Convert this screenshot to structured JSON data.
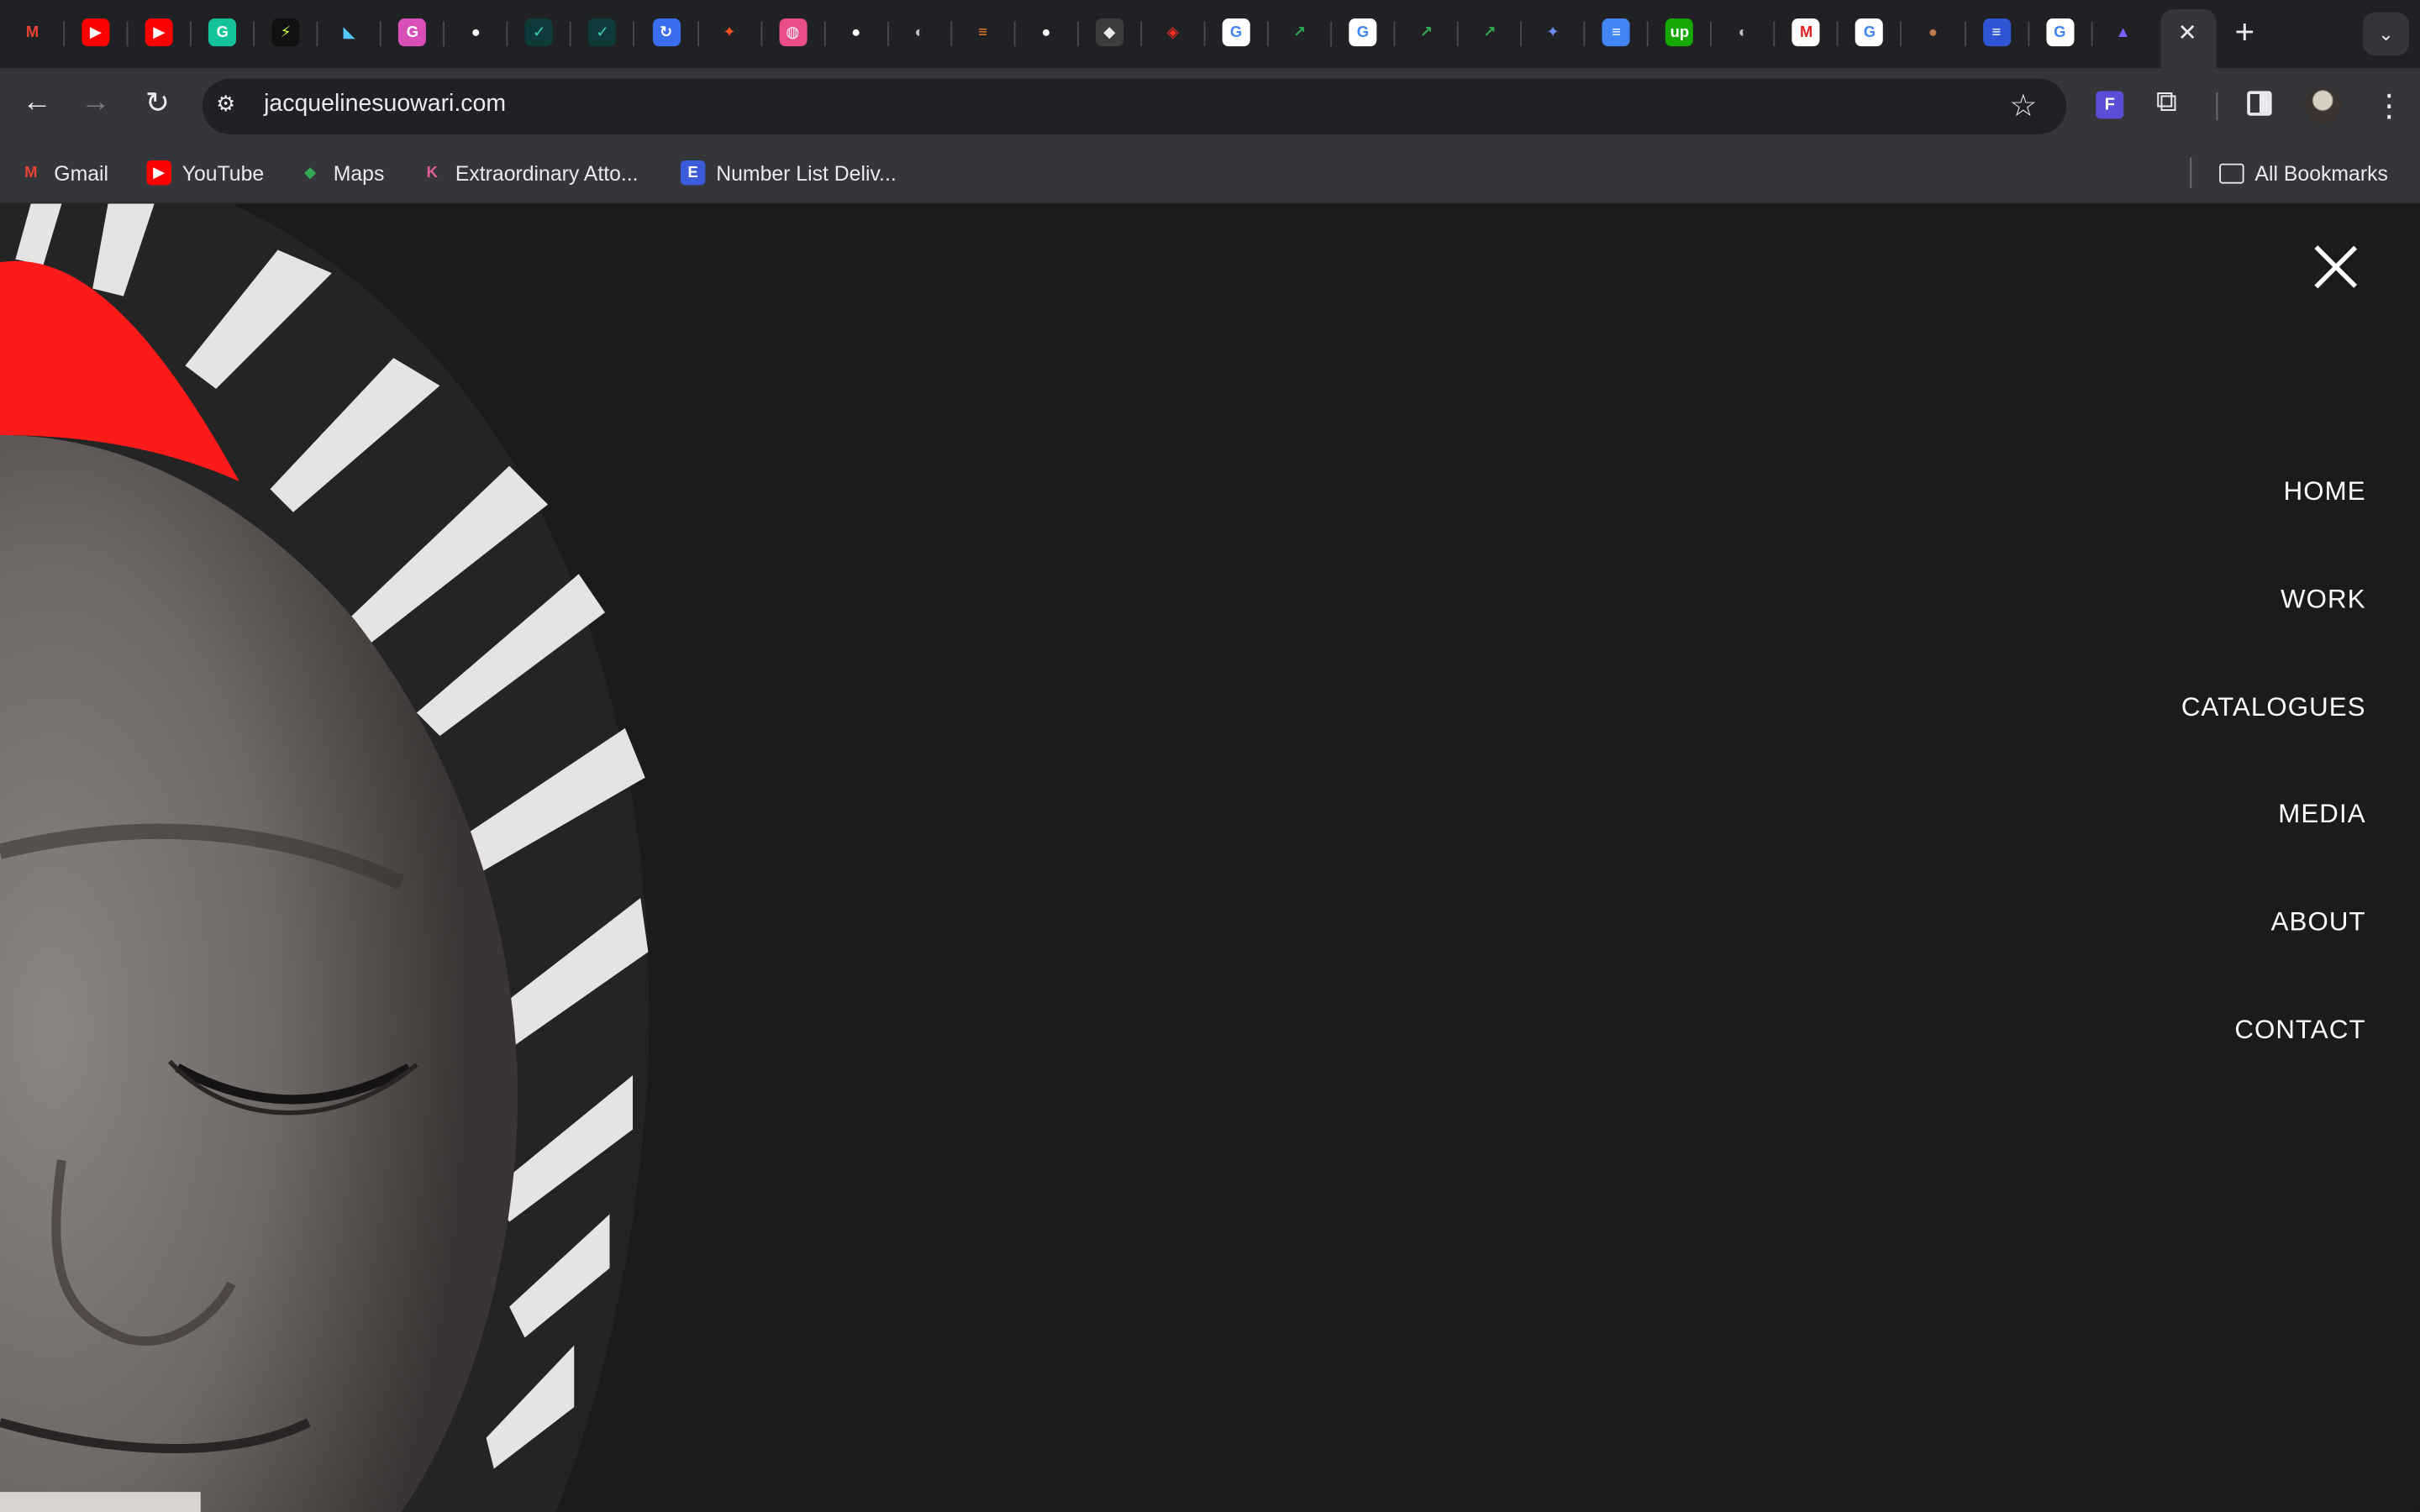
{
  "browser": {
    "tabs": [
      {
        "icon": "gmail-icon",
        "glyph": "M",
        "color": "#ea4335",
        "bg": "transparent"
      },
      {
        "icon": "youtube-icon",
        "glyph": "▶",
        "color": "#ffffff",
        "bg": "#ff0000"
      },
      {
        "icon": "youtube-icon",
        "glyph": "▶",
        "color": "#ffffff",
        "bg": "#ff0000"
      },
      {
        "icon": "grammarly-icon",
        "glyph": "G",
        "color": "#ffffff",
        "bg": "#15c39a"
      },
      {
        "icon": "bolt-icon",
        "glyph": "⚡",
        "color": "#c8ff3c",
        "bg": "#111111"
      },
      {
        "icon": "flutter-icon",
        "glyph": "◣",
        "color": "#54c5f8",
        "bg": "transparent"
      },
      {
        "icon": "g-icon",
        "glyph": "G",
        "color": "#ffffff",
        "bg": "#d94fb8"
      },
      {
        "icon": "github-icon",
        "glyph": "●",
        "color": "#ffffff",
        "bg": "transparent"
      },
      {
        "icon": "check-icon",
        "glyph": "✓",
        "color": "#38d6b0",
        "bg": "#0e3b3a"
      },
      {
        "icon": "check-icon",
        "glyph": "✓",
        "color": "#38d6b0",
        "bg": "#0e3b3a"
      },
      {
        "icon": "link-icon",
        "glyph": "↻",
        "color": "#ffffff",
        "bg": "#3a6df0"
      },
      {
        "icon": "figma-icon",
        "glyph": "✦",
        "color": "#f24e1e",
        "bg": "transparent"
      },
      {
        "icon": "dribbble-icon",
        "glyph": "◍",
        "color": "#ffffff",
        "bg": "#ea4c89"
      },
      {
        "icon": "github-icon",
        "glyph": "●",
        "color": "#ffffff",
        "bg": "transparent"
      },
      {
        "icon": "globe-icon",
        "glyph": "◐",
        "color": "#bdc1c6",
        "bg": "transparent"
      },
      {
        "icon": "stackoverflow-icon",
        "glyph": "≡",
        "color": "#f48024",
        "bg": "transparent"
      },
      {
        "icon": "github-icon",
        "glyph": "●",
        "color": "#ffffff",
        "bg": "transparent"
      },
      {
        "icon": "box-icon",
        "glyph": "◆",
        "color": "#e8eaed",
        "bg": "#3c3c3c"
      },
      {
        "icon": "laravel-icon",
        "glyph": "◈",
        "color": "#ff2d20",
        "bg": "transparent"
      },
      {
        "icon": "google-icon",
        "glyph": "G",
        "color": "#4285f4",
        "bg": "#ffffff"
      },
      {
        "icon": "chart-line-icon",
        "glyph": "↗",
        "color": "#34a853",
        "bg": "transparent"
      },
      {
        "icon": "google-icon",
        "glyph": "G",
        "color": "#4285f4",
        "bg": "#ffffff"
      },
      {
        "icon": "chart-line-icon",
        "glyph": "↗",
        "color": "#34a853",
        "bg": "transparent"
      },
      {
        "icon": "chart-line-icon",
        "glyph": "↗",
        "color": "#34a853",
        "bg": "transparent"
      },
      {
        "icon": "gemini-icon",
        "glyph": "✦",
        "color": "#6c8cff",
        "bg": "transparent"
      },
      {
        "icon": "docs-icon",
        "glyph": "≡",
        "color": "#ffffff",
        "bg": "#4285f4"
      },
      {
        "icon": "upwork-icon",
        "glyph": "up",
        "color": "#ffffff",
        "bg": "#14a800"
      },
      {
        "icon": "globe-icon",
        "glyph": "◐",
        "color": "#bdc1c6",
        "bg": "transparent"
      },
      {
        "icon": "m-icon",
        "glyph": "M",
        "color": "#e02020",
        "bg": "#ffffff"
      },
      {
        "icon": "google-icon",
        "glyph": "G",
        "color": "#4285f4",
        "bg": "#ffffff"
      },
      {
        "icon": "avatar-icon",
        "glyph": "●",
        "color": "#b97a4a",
        "bg": "transparent"
      },
      {
        "icon": "list-icon",
        "glyph": "≡",
        "color": "#ffffff",
        "bg": "#2f55d4"
      },
      {
        "icon": "google-icon",
        "glyph": "G",
        "color": "#4285f4",
        "bg": "#ffffff"
      },
      {
        "icon": "triangle-icon",
        "glyph": "▲",
        "color": "#7b5cff",
        "bg": "transparent"
      }
    ],
    "active_tab_close": "✕",
    "new_tab": "+",
    "tab_search": "⌄",
    "nav": {
      "back": "←",
      "forward": "→",
      "reload": "↻"
    },
    "site_info": "⚙",
    "url": "jacquelinesuowari.com",
    "star": "☆",
    "extension_glyph": "F",
    "puzzle": "⧉",
    "menu": "⋮",
    "bookmarks": [
      {
        "label": "Gmail",
        "glyph": "M",
        "color": "#ea4335",
        "bg": "transparent"
      },
      {
        "label": "YouTube",
        "glyph": "▶",
        "color": "#ffffff",
        "bg": "#ff0000"
      },
      {
        "label": "Maps",
        "glyph": "◆",
        "color": "#34a853",
        "bg": "transparent"
      },
      {
        "label": "Extraordinary Atto...",
        "glyph": "K",
        "color": "#e25c9c",
        "bg": "transparent"
      },
      {
        "label": "Number List Deliv...",
        "glyph": "E",
        "color": "#ffffff",
        "bg": "#3b5bdb"
      }
    ],
    "all_bookmarks": "All Bookmarks"
  },
  "site": {
    "menu": [
      "HOME",
      "WORK",
      "CATALOGUES",
      "MEDIA",
      "ABOUT",
      "CONTACT"
    ],
    "colors": {
      "background": "#1b1b1c",
      "accent": "#ff1a1a",
      "text": "#ffffff"
    }
  }
}
